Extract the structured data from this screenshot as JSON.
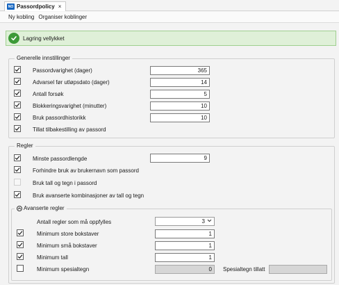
{
  "tab": {
    "logo": "NO",
    "title": "Passordpolicy",
    "close": "×"
  },
  "menu": {
    "items": [
      "Ny kobling",
      "Organiser koblinger"
    ]
  },
  "banner": {
    "text": "Lagring vellykket",
    "icon": "check-circle-icon",
    "color": "#3c9a38"
  },
  "general": {
    "legend": "Generelle innstillinger",
    "rows": [
      {
        "label": "Passordvarighet (dager)",
        "checked": true,
        "value": "365"
      },
      {
        "label": "Advarsel før utløpsdato (dager)",
        "checked": true,
        "value": "14"
      },
      {
        "label": "Antall forsøk",
        "checked": true,
        "value": "5"
      },
      {
        "label": "Blokkeringsvarighet (minutter)",
        "checked": true,
        "value": "10"
      },
      {
        "label": "Bruk passordhistorikk",
        "checked": true,
        "value": "10"
      },
      {
        "label": "Tillat tilbakestilling av passord",
        "checked": true
      }
    ]
  },
  "rules": {
    "legend": "Regler",
    "rows": [
      {
        "label": "Minste passordlengde",
        "checked": true,
        "value": "9"
      },
      {
        "label": "Forhindre bruk av brukernavn som passord",
        "checked": true
      },
      {
        "label": "Bruk tall og tegn i passord",
        "checked": false,
        "disabled": true
      },
      {
        "label": "Bruk avanserte kombinasjoner av tall og tegn",
        "checked": true
      }
    ]
  },
  "advanced": {
    "legend": "Avanserte regler",
    "count_label": "Antall regler som må oppfylles",
    "count_value": "3",
    "rows": [
      {
        "label": "Minimum store bokstaver",
        "checked": true,
        "value": "1"
      },
      {
        "label": "Minimum små bokstaver",
        "checked": true,
        "value": "1"
      },
      {
        "label": "Minimum tall",
        "checked": true,
        "value": "1"
      },
      {
        "label": "Minimum spesialtegn",
        "checked": false,
        "value": "0",
        "disabled": true
      }
    ],
    "special_allowed_label": "Spesialtegn tillatt",
    "special_allowed_value": ""
  }
}
